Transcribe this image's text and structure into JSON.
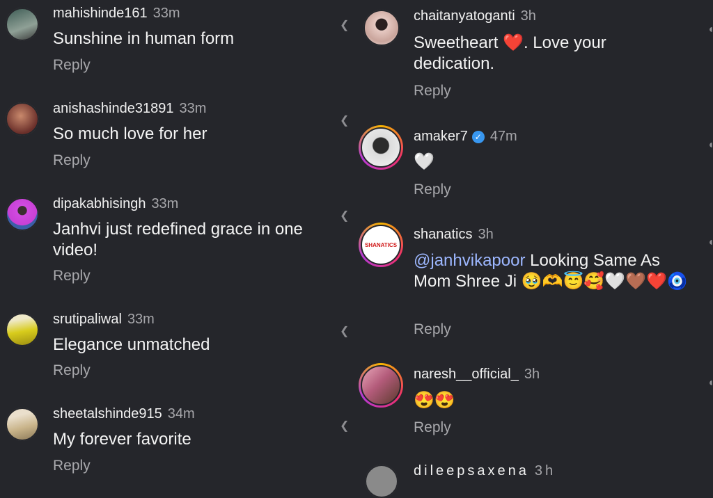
{
  "left_comments": [
    {
      "username": "mahishinde161",
      "time": "33m",
      "text": "Sunshine in human form",
      "reply": "Reply",
      "avatar_color": "#6b7d6f"
    },
    {
      "username": "anishashinde31891",
      "time": "33m",
      "text": "So much love for her",
      "reply": "Reply",
      "avatar_color": "#7e4a3c"
    },
    {
      "username": "dipakabhisingh",
      "time": "33m",
      "text": "Janhvi just redefined grace in one video!",
      "reply": "Reply",
      "avatar_color": "#d147d6"
    },
    {
      "username": "srutipaliwal",
      "time": "33m",
      "text": "Elegance unmatched",
      "reply": "Reply",
      "avatar_color": "#d4c91a"
    },
    {
      "username": "sheetalshinde915",
      "time": "34m",
      "text": "My forever favorite",
      "reply": "Reply",
      "avatar_color": "#c9b48a"
    }
  ],
  "right_comments": [
    {
      "username": "chaitanyatoganti",
      "time": "3h",
      "text": "Sweetheart ❤️. Love your dedication.",
      "reply": "Reply",
      "avatar_color": "#c7a39a"
    },
    {
      "username": "amaker7",
      "time": "47m",
      "text": "🤍",
      "reply": "Reply",
      "avatar_color": "#e9e9e9",
      "verified": "✓"
    },
    {
      "username": "shanatics",
      "time": "3h",
      "mention": "@janhvikapoor",
      "text": " Looking Same As Mom Shree Ji 🥹🫶😇🥰🤍🤎❤️🧿",
      "reply": "Reply",
      "avatar_label": "SHANATICS",
      "avatar_color": "#ffffff"
    },
    {
      "username": "naresh__official_",
      "time": "3h",
      "text": "😍😍",
      "reply": "Reply",
      "avatar_color": "#b35b7a"
    },
    {
      "username": "dileepsaxena",
      "time": "3h",
      "avatar_color": "#888888"
    }
  ],
  "accent": {
    "mention": "#9db7ff",
    "verified": "#3897f0"
  }
}
